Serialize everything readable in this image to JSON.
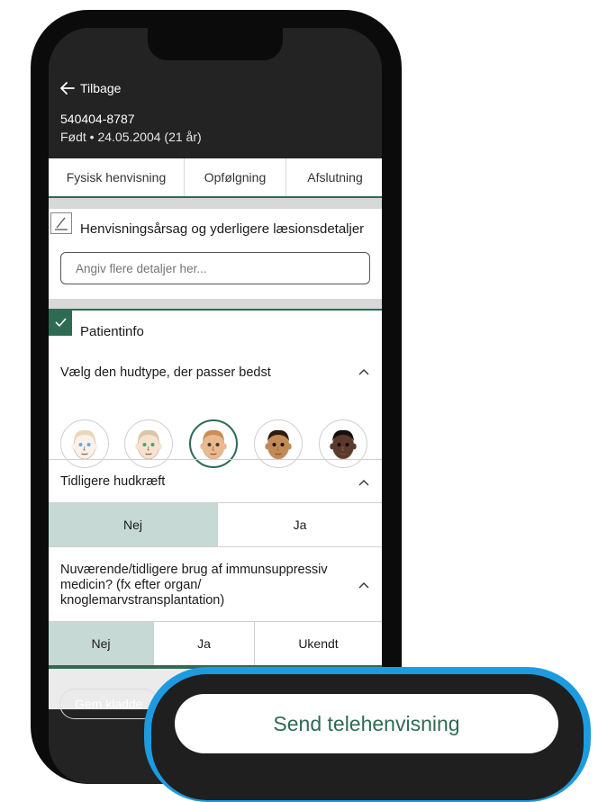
{
  "header": {
    "back_label": "Tilbage",
    "cpr": "540404-8787",
    "born": "Født • 24.05.2004 (21 år)"
  },
  "tabs": [
    "Fysisk henvisning",
    "Opfølgning",
    "Afslutning"
  ],
  "referral": {
    "title": "Henvisningsårsag og yderligere læsionsdetaljer",
    "placeholder": "Angiv flere detaljer her..."
  },
  "patient": {
    "title": "Patientinfo",
    "skin_question": "Vælg den hudtype, der passer bedst",
    "skin_types": [
      {
        "tone": "#fbf1ea",
        "hair": "#ead7b8",
        "eye": "#6aa7d6"
      },
      {
        "tone": "#f6e2cf",
        "hair": "#d9c7a8",
        "eye": "#4f9e73"
      },
      {
        "tone": "#eab98e",
        "hair": "#c98d55",
        "eye": "#4a3a2a"
      },
      {
        "tone": "#c28a55",
        "hair": "#2a1c12",
        "eye": "#1d1208"
      },
      {
        "tone": "#5b3a2b",
        "hair": "#15100c",
        "eye": "#120a06"
      }
    ],
    "selected_skin_index": 2,
    "cancer_question": "Tidligere hudkræft",
    "cancer_options": [
      "Nej",
      "Ja"
    ],
    "cancer_selected": "Nej",
    "immuno_question": "Nuværende/tidligere brug af immunsuppressiv medicin? (fx efter organ/ knoglemarvstransplantation)",
    "immuno_options": [
      "Nej",
      "Ja",
      "Ukendt"
    ],
    "immuno_selected": "Nej"
  },
  "footer": {
    "draft_label": "Gem kladde",
    "send_label": "Send telehenvisning"
  },
  "colors": {
    "accent": "#2e6b53",
    "selected_option": "#c6d9d4",
    "highlight_ring": "#1d9be0",
    "header_bg": "#222322"
  }
}
